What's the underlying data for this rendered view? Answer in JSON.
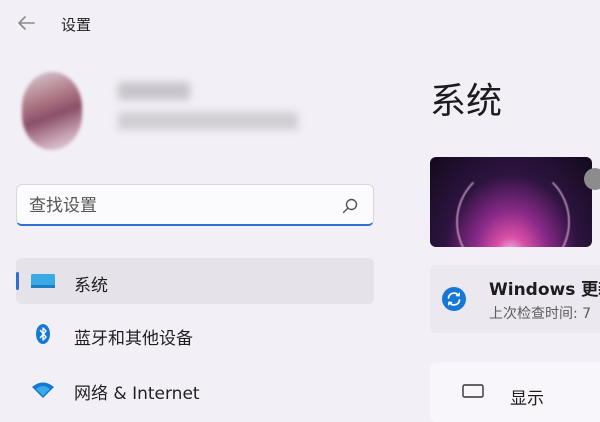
{
  "app": {
    "title": "设置"
  },
  "search": {
    "placeholder": "查找设置"
  },
  "sidebar": {
    "items": [
      {
        "label": "系统",
        "icon": "monitor-icon",
        "active": true
      },
      {
        "label": "蓝牙和其他设备",
        "icon": "bluetooth-icon",
        "active": false
      },
      {
        "label": "网络 & Internet",
        "icon": "wifi-icon",
        "active": false
      }
    ]
  },
  "main": {
    "title": "系统",
    "update": {
      "title": "Windows 更新",
      "subtitle": "上次检查时间: 7"
    },
    "display": {
      "label": "显示"
    }
  },
  "colors": {
    "accent": "#2e6fd1",
    "background": "#f3eff6"
  }
}
